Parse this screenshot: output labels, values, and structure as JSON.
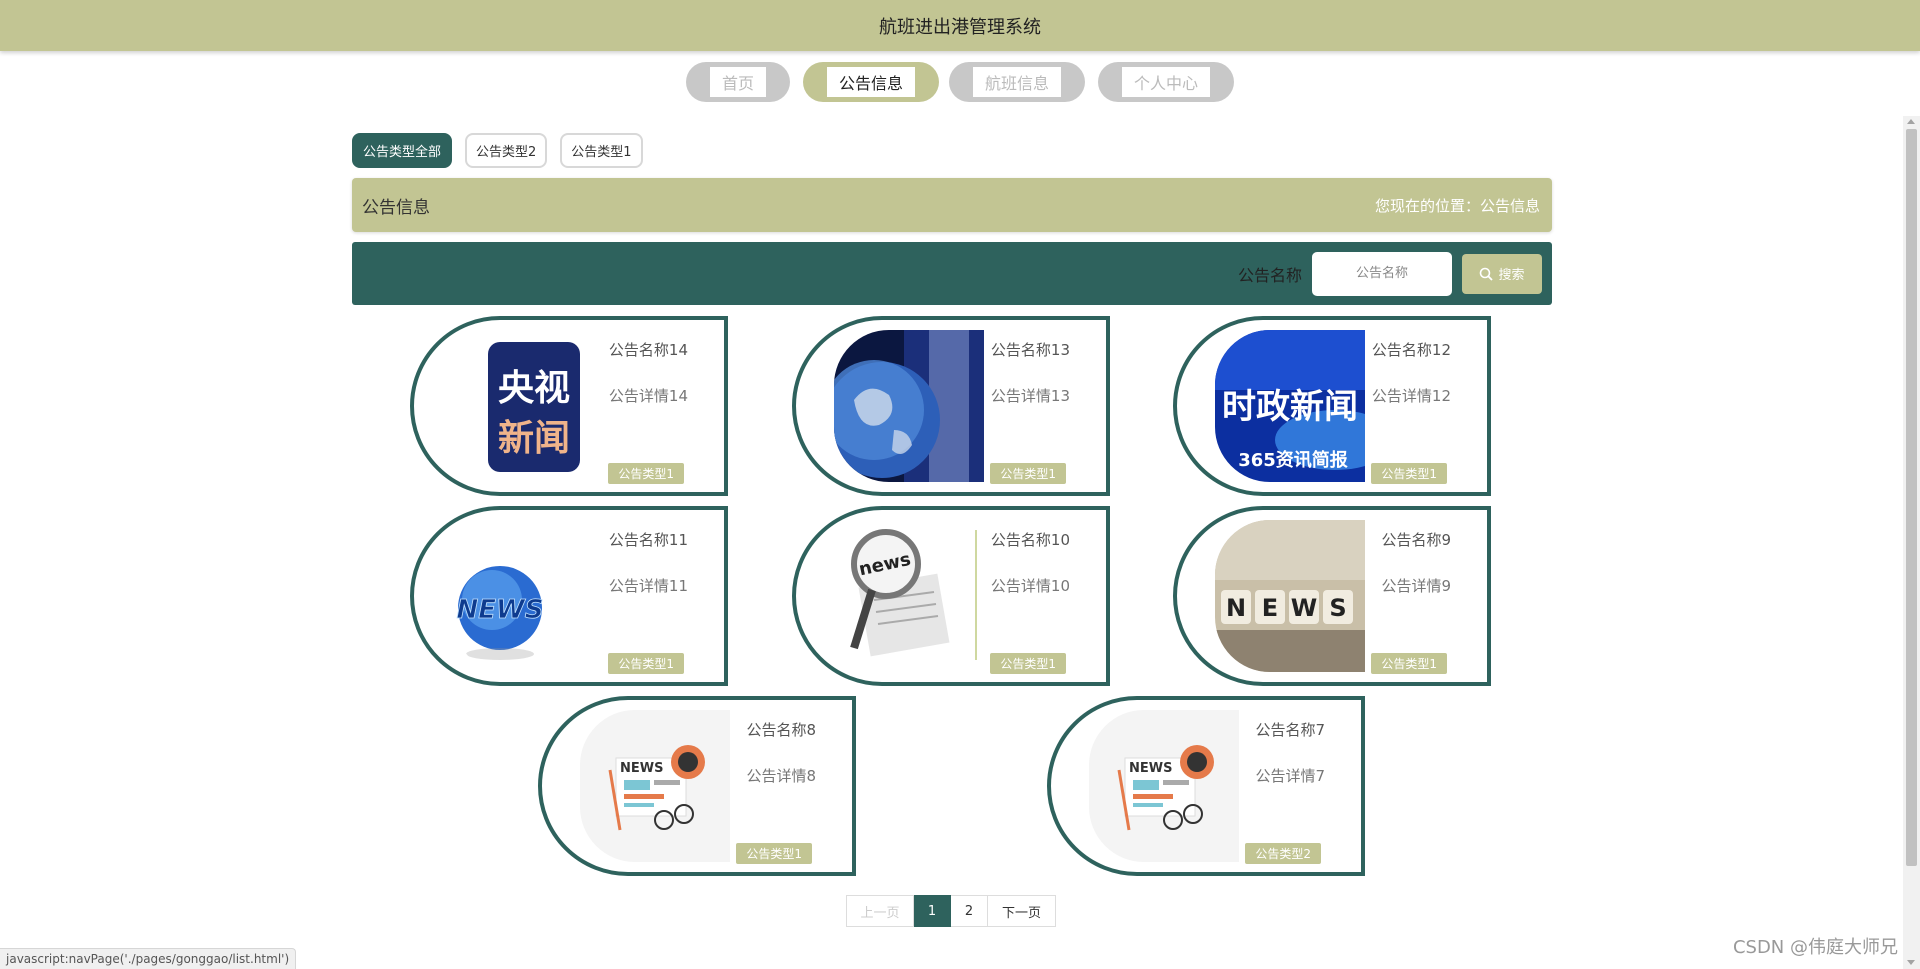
{
  "app": {
    "title": "航班进出港管理系统"
  },
  "nav": {
    "items": [
      {
        "label": "首页"
      },
      {
        "label": "公告信息"
      },
      {
        "label": "航班信息"
      },
      {
        "label": "个人中心"
      }
    ],
    "active": 1
  },
  "tabs": {
    "items": [
      {
        "label": "公告类型全部"
      },
      {
        "label": "公告类型2"
      },
      {
        "label": "公告类型1"
      }
    ],
    "active": 0
  },
  "header": {
    "title": "公告信息",
    "location": "您现在的位置：公告信息"
  },
  "search": {
    "label": "公告名称",
    "placeholder": "公告名称",
    "button_label": "搜索",
    "button_icon": "search-icon"
  },
  "cards": [
    {
      "name": "公告名称14",
      "detail": "公告详情14",
      "type": "公告类型1",
      "image": "央视新闻 logo"
    },
    {
      "name": "公告名称13",
      "detail": "公告详情13",
      "type": "公告类型1",
      "image": "globe broadcast"
    },
    {
      "name": "公告名称12",
      "detail": "公告详情12",
      "type": "公告类型1",
      "image": "时政新闻 banner"
    },
    {
      "name": "公告名称11",
      "detail": "公告详情11",
      "type": "公告类型1",
      "image": "NEWS globe"
    },
    {
      "name": "公告名称10",
      "detail": "公告详情10",
      "type": "公告类型1",
      "image": "magnifier newspaper"
    },
    {
      "name": "公告名称9",
      "detail": "公告详情9",
      "type": "公告类型1",
      "image": "NEWS blocks"
    },
    {
      "name": "公告名称8",
      "detail": "公告详情8",
      "type": "公告类型1",
      "image": "NEWS illustration"
    },
    {
      "name": "公告名称7",
      "detail": "公告详情7",
      "type": "公告类型2",
      "image": "NEWS illustration"
    }
  ],
  "images": {
    "cctv_line1": "央视",
    "cctv_line2": "新闻",
    "politics_title": "时政新闻",
    "politics_sub": "365资讯简报",
    "news_globe": "NEWS",
    "magnifier_word": "news",
    "blocks": [
      "N",
      "E",
      "W",
      "S"
    ],
    "illustration_word": "NEWS"
  },
  "pagination": {
    "prev": "上一页",
    "pages": [
      "1",
      "2"
    ],
    "active": "1",
    "next": "下一页"
  },
  "status_bar": "javascript:navPage('./pages/gonggao/list.html')",
  "watermark": "CSDN @伟庭大师兄",
  "colors": {
    "accent_green": "#2e625d",
    "khaki": "#c2c593"
  }
}
